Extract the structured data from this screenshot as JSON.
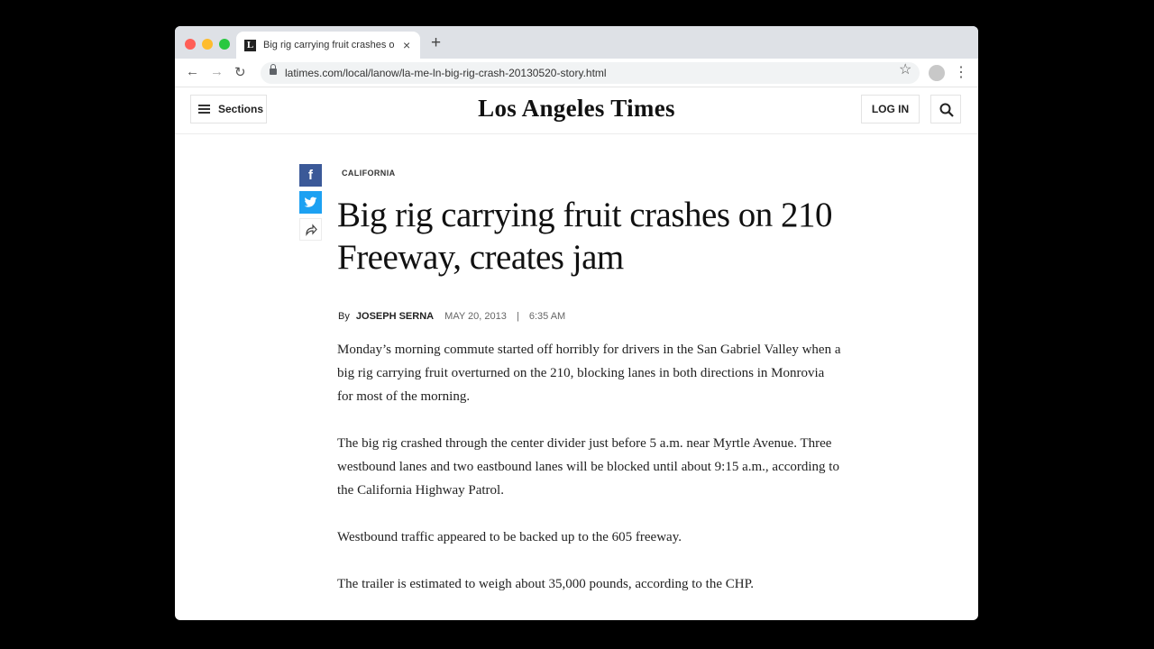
{
  "browser": {
    "tab_title": "Big rig carrying fruit crashes on 210",
    "favicon_letter": "L",
    "tab_close": "×",
    "new_tab": "+",
    "url": "latimes.com/local/lanow/la-me-ln-big-rig-crash-20130520-story.html",
    "back_glyph": "←",
    "forward_glyph": "→",
    "reload_glyph": "↻",
    "star_glyph": "☆",
    "menu_glyph": "⋮"
  },
  "site": {
    "sections_label": "Sections",
    "logo": "Los Angeles Times",
    "login_label": "LOG IN"
  },
  "share": {
    "facebook_glyph": "f"
  },
  "article": {
    "kicker": "CALIFORNIA",
    "headline": "Big rig carrying fruit crashes on 210 Freeway, creates jam",
    "byline_prefix": "By",
    "author": "JOSEPH SERNA",
    "date": "MAY 20, 2013",
    "separator": "|",
    "time": "6:35 AM",
    "paragraphs": [
      "Monday’s morning commute started off horribly for drivers in the San Gabriel Valley when a big rig carrying fruit overturned on the 210, blocking lanes in both directions in Monrovia for most of the morning.",
      "The big rig crashed through the center divider just before 5 a.m. near Myrtle Avenue. Three westbound lanes and two eastbound lanes will be blocked until about 9:15 a.m., according to the California Highway Patrol.",
      "Westbound traffic appeared to be backed up to the 605 freeway.",
      "The trailer is estimated to weigh about 35,000 pounds, according to the CHP."
    ]
  },
  "colors": {
    "facebook": "#3b5998",
    "twitter": "#1da1f2",
    "tab_bar": "#dee1e6"
  }
}
